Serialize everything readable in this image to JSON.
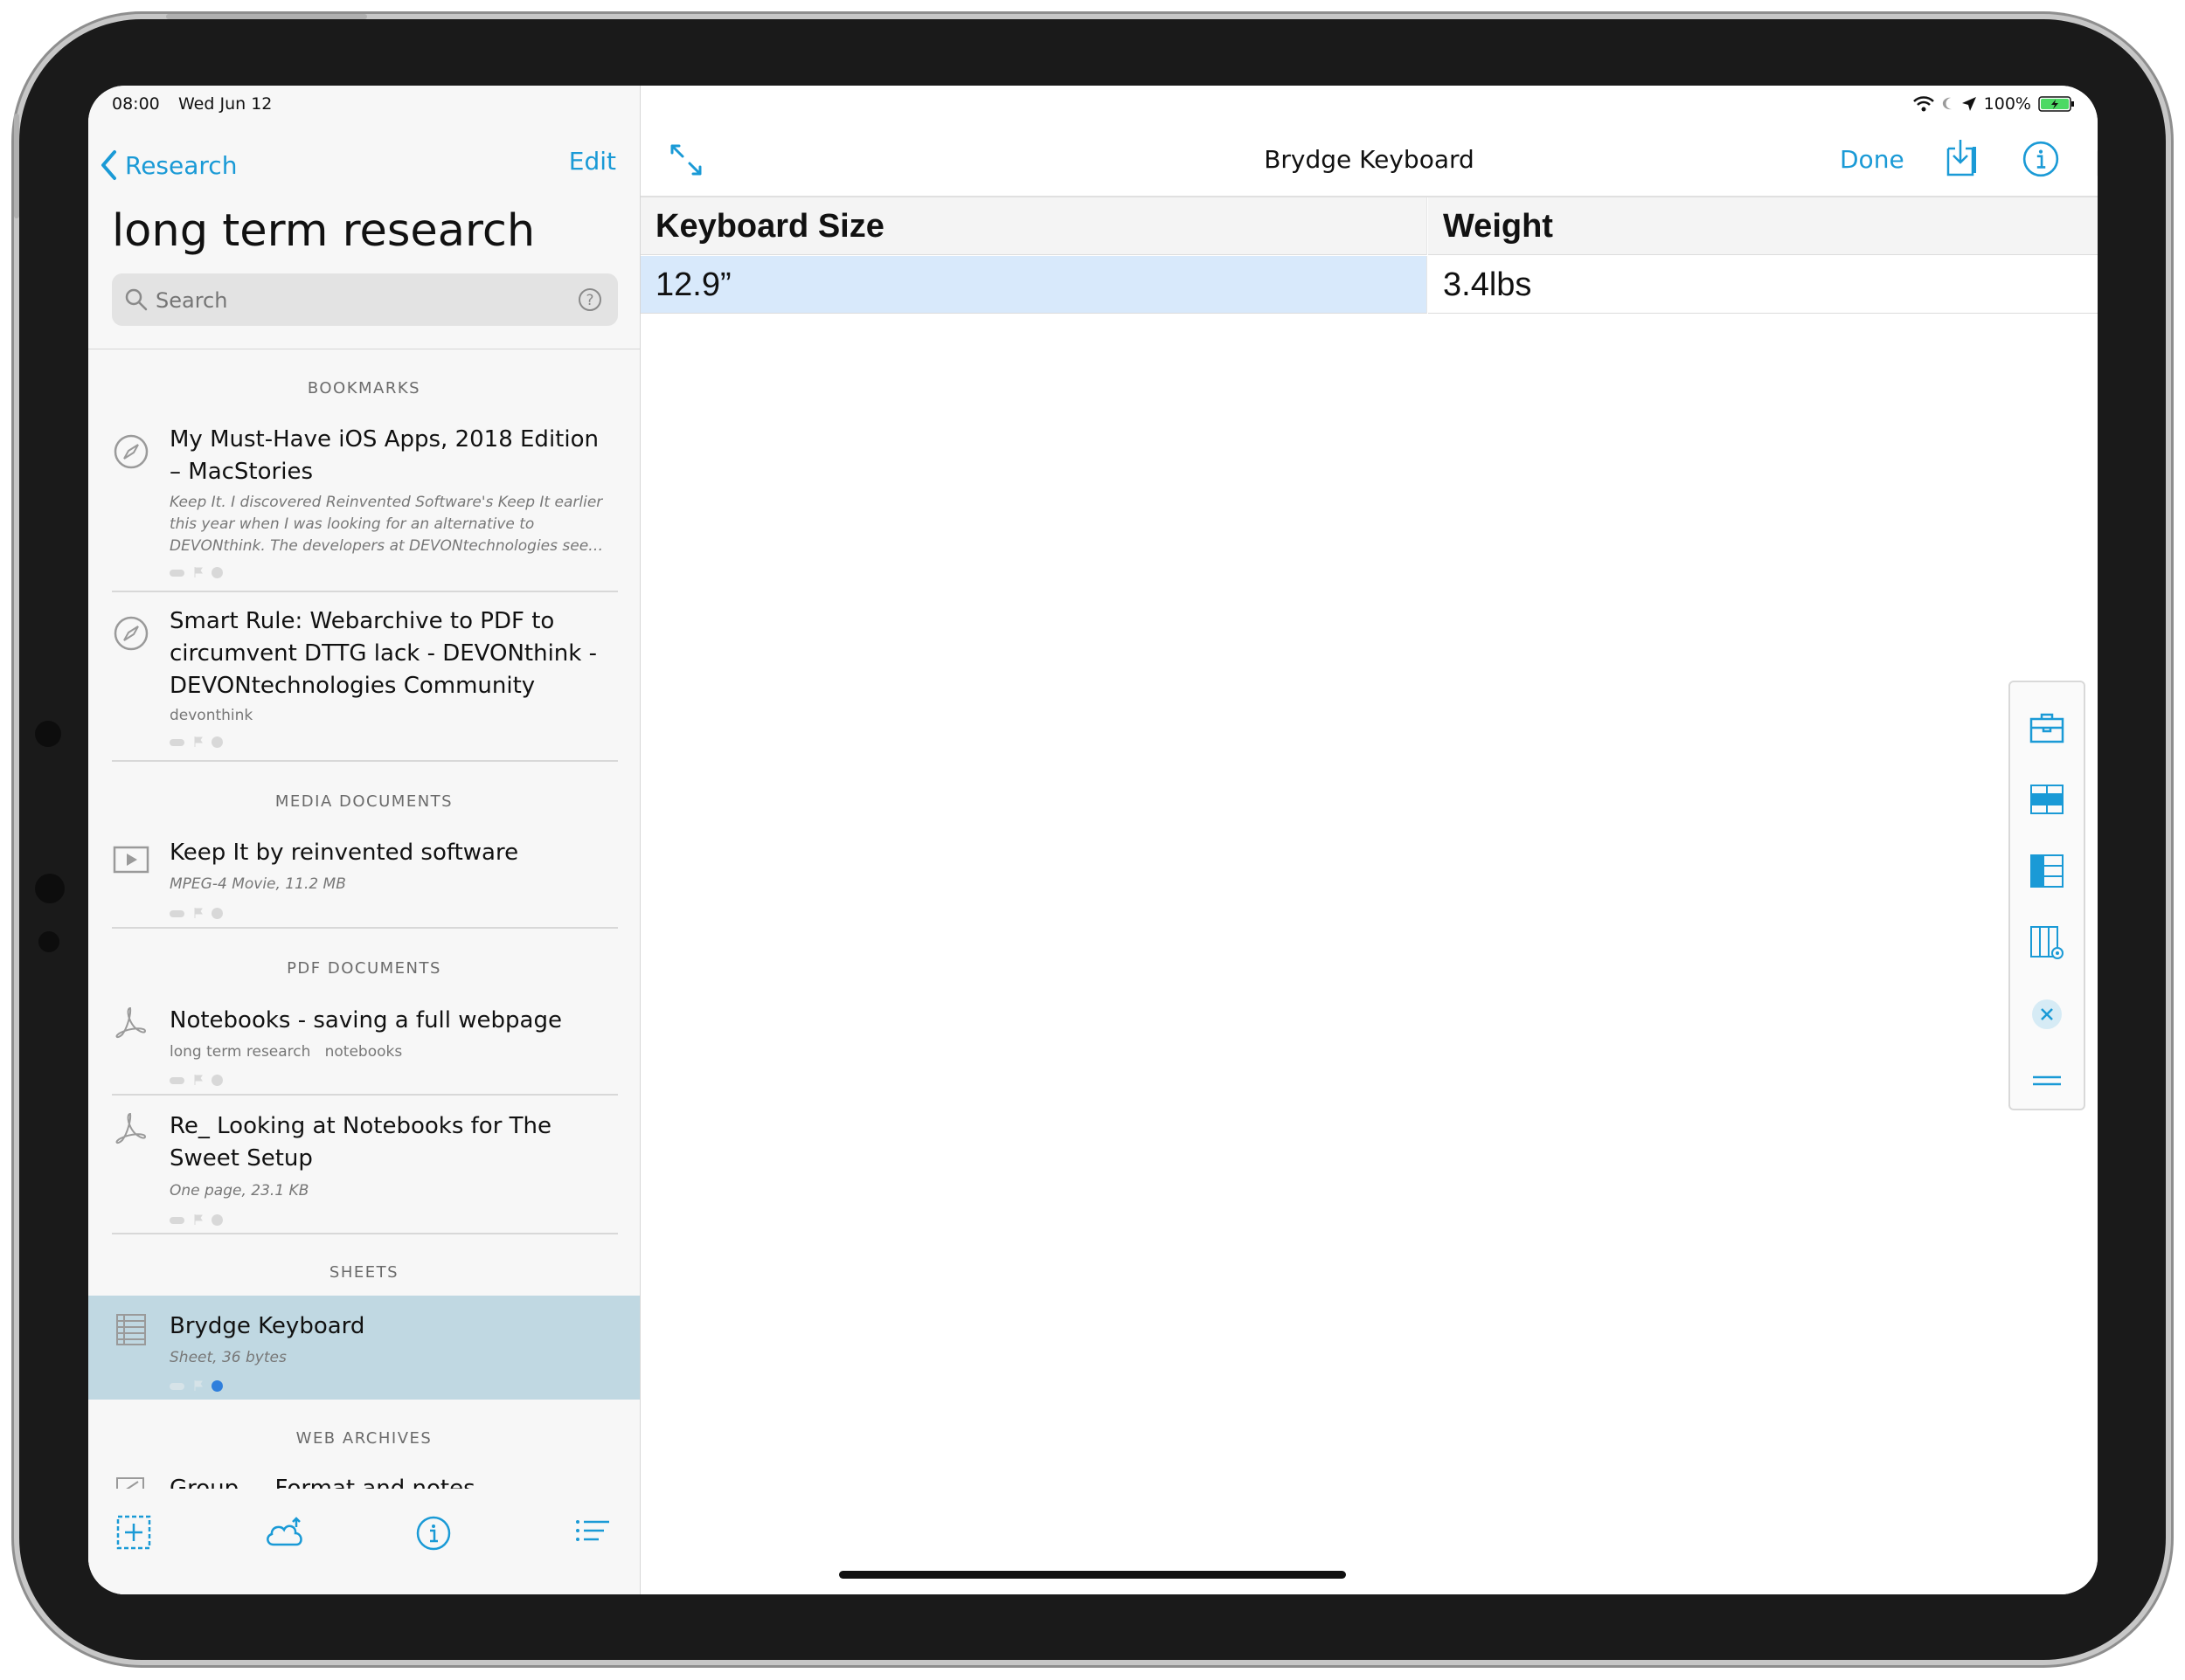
{
  "status_bar": {
    "time": "08:00",
    "date": "Wed Jun 12",
    "battery": "100%"
  },
  "sidebar": {
    "back_label": "Research",
    "edit_label": "Edit",
    "title": "long term research",
    "search_placeholder": "Search",
    "sections": {
      "bookmarks": "BOOKMARKS",
      "media": "MEDIA DOCUMENTS",
      "pdf": "PDF DOCUMENTS",
      "sheets": "SHEETS",
      "web_archives": "WEB ARCHIVES"
    },
    "items": [
      {
        "title": "My Must-Have iOS Apps, 2018 Edition – MacStories",
        "subtitle": "Keep It. I discovered Reinvented Software's Keep It earlier this year when I was looking for an alternative to DEVONthink. The developers at DEVONtechnologies see…",
        "icon": "safari-compass-icon"
      },
      {
        "title": "Smart Rule: Webarchive to PDF to circumvent DTTG lack - DEVONthink - DEVONtechnologies Community",
        "subtitle": "devonthink",
        "icon": "safari-compass-icon"
      },
      {
        "title": "Keep It by reinvented software",
        "subtitle": "MPEG-4 Movie, 11.2 MB",
        "icon": "movie-icon"
      },
      {
        "title": "Notebooks - saving a full webpage",
        "subtitle": "long term research   notebooks",
        "icon": "pdf-icon"
      },
      {
        "title": "Re_ Looking at Notebooks for The Sweet Setup",
        "subtitle": "One page, 23.1 KB",
        "icon": "pdf-icon"
      },
      {
        "title": "Brydge Keyboard",
        "subtitle": "Sheet, 36 bytes",
        "icon": "sheet-icon"
      },
      {
        "title": "Group.... Format and notes",
        "icon": "webarchive-icon"
      }
    ]
  },
  "bottom_toolbar": {
    "icons": [
      "add-icon",
      "cloud-sync-icon",
      "info-icon",
      "list-sort-icon"
    ]
  },
  "main": {
    "title": "Brydge Keyboard",
    "done_label": "Done",
    "table": {
      "headers": [
        "Keyboard Size",
        "Weight"
      ],
      "rows": [
        [
          "12.9”",
          "3.4lbs"
        ]
      ]
    }
  },
  "colors": {
    "accent": "#1a9ad6",
    "selection": "#c0d8e2",
    "cell_highlight": "#d8e9fb"
  }
}
